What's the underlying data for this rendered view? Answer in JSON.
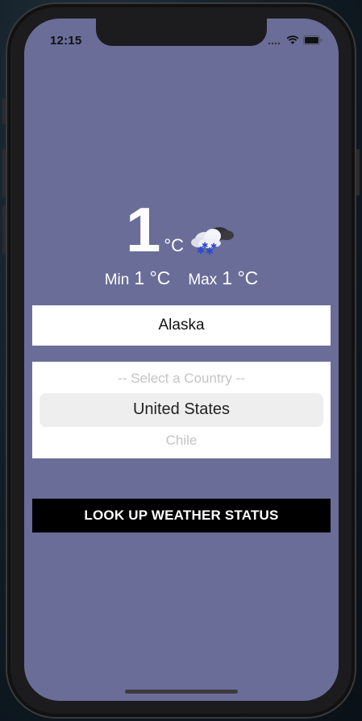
{
  "status_bar": {
    "time": "12:15"
  },
  "weather": {
    "temperature": "1",
    "unit": "°C",
    "condition_icon": "snow-cloud-icon",
    "min_label": "Min",
    "min_value": "1 °C",
    "max_label": "Max",
    "max_value": "1 °C"
  },
  "city": {
    "value": "Alaska"
  },
  "country_picker": {
    "options": [
      "-- Select a Country --",
      "United States",
      "Chile"
    ],
    "selected": "United States"
  },
  "lookup_button": {
    "label": "LOOK UP WEATHER STATUS"
  },
  "colors": {
    "background": "#696d98",
    "button": "#000000",
    "button_text": "#ffffff"
  }
}
